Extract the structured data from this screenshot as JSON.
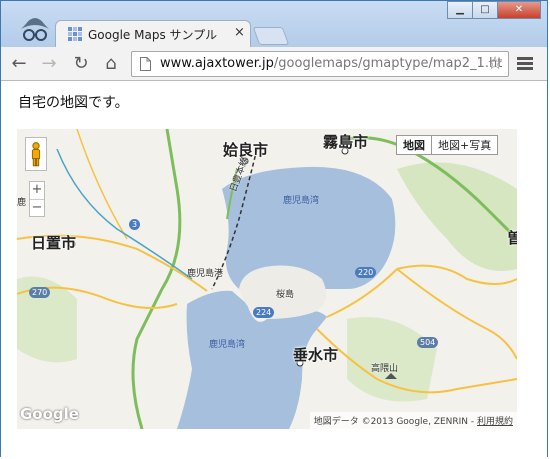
{
  "browser": {
    "tab_title": "Google Maps サンプル",
    "tab_close": "×",
    "url_host": "www.ajaxtower.jp",
    "url_path": "/googlemaps/gmaptype/map2_1.ht",
    "buttons": {
      "back": "←",
      "forward": "→",
      "reload": "↻",
      "home": "⌂",
      "star": "☆"
    },
    "window": {
      "minimize": "▁",
      "maximize": "□",
      "close": "✕"
    }
  },
  "page": {
    "intro": "自宅の地図です。"
  },
  "map": {
    "map_type_buttons": [
      "地図",
      "地図+写真"
    ],
    "active_map_type": "地図",
    "zoom_in": "+",
    "zoom_out": "−",
    "attribution": "地図データ ©2013 Google, ZENRIN - ",
    "attribution_link": "利用規約",
    "logo": "Google",
    "labels": {
      "aira": "姶良市",
      "kirishima": "霧島市",
      "hioki": "日置市",
      "tarumizu": "垂水市",
      "kagoshima_bay_north": "鹿児島湾",
      "kagoshima_port": "鹿児島港",
      "sakurajima": "桜島",
      "kagoshima_bay_south": "鹿児島湾",
      "takatogeyama": "高隈山",
      "nippo_line": "日豊本線",
      "edge_right": "曽",
      "edge_left": "鹿"
    },
    "route_shields": {
      "r3": "3",
      "r220": "220",
      "r224": "224",
      "r270": "270",
      "r504": "504"
    },
    "colors": {
      "water": "#a5bfdd",
      "land": "#f3f1ec",
      "park": "#c8dfb0",
      "highway": "#7ebd5c",
      "road": "#f6c244",
      "rail": "#333333"
    }
  }
}
